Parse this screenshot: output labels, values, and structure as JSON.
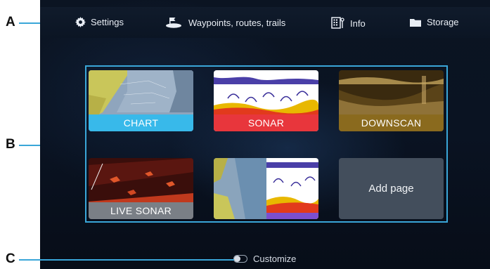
{
  "callouts": {
    "a": "A",
    "b": "B",
    "c": "C"
  },
  "topbar": {
    "items": [
      {
        "label": "Settings",
        "icon": "gear-icon"
      },
      {
        "label": "Waypoints, routes, trails",
        "icon": "waypoint-flag-icon"
      },
      {
        "label": "Info",
        "icon": "info-icon"
      },
      {
        "label": "Storage",
        "icon": "folder-icon"
      }
    ]
  },
  "tiles": [
    {
      "label": "CHART",
      "color": "#38b9ea"
    },
    {
      "label": "SONAR",
      "color": "#e8363c"
    },
    {
      "label": "DOWNSCAN",
      "color": "#8a6a1e"
    },
    {
      "label": "LIVE SONAR",
      "color": "#7a7f86"
    },
    {
      "label": "",
      "color": ""
    },
    {
      "label": "Add page",
      "color": "#434e5c"
    }
  ],
  "footer": {
    "customize_label": "Customize"
  },
  "colors": {
    "accent": "#3aa6d8",
    "background": "#0a1322"
  }
}
